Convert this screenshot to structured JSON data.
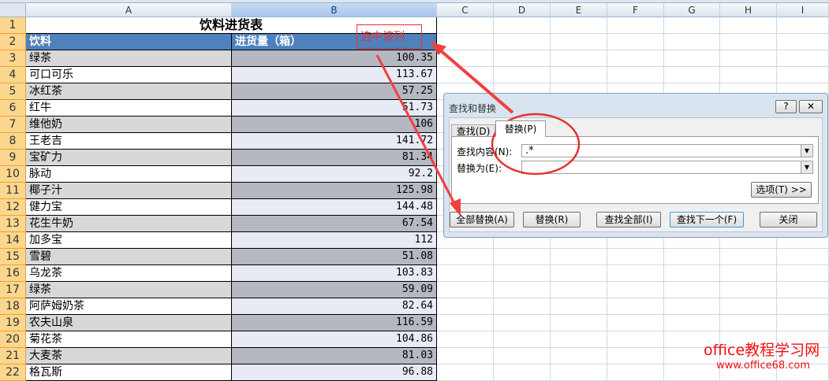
{
  "columns": [
    "A",
    "B",
    "C",
    "D",
    "E",
    "F",
    "G",
    "H",
    "I"
  ],
  "sheet": {
    "title": "饮料进货表",
    "headers": [
      "饮料",
      "进货量（箱）"
    ],
    "rows": [
      [
        "绿茶",
        "100.35"
      ],
      [
        "可口可乐",
        "113.67"
      ],
      [
        "冰红茶",
        "57.25"
      ],
      [
        "红牛",
        "51.73"
      ],
      [
        "维他奶",
        "106"
      ],
      [
        "王老吉",
        "141.72"
      ],
      [
        "宝矿力",
        "81.34"
      ],
      [
        "脉动",
        "92.2"
      ],
      [
        "椰子汁",
        "125.98"
      ],
      [
        "健力宝",
        "144.48"
      ],
      [
        "花生牛奶",
        "67.54"
      ],
      [
        "加多宝",
        "112"
      ],
      [
        "雪碧",
        "51.08"
      ],
      [
        "乌龙茶",
        "103.83"
      ],
      [
        "绿茶",
        "59.09"
      ],
      [
        "阿萨姆奶茶",
        "82.64"
      ],
      [
        "农夫山泉",
        "116.59"
      ],
      [
        "菊花茶",
        "104.86"
      ],
      [
        "大麦茶",
        "81.03"
      ],
      [
        "格瓦斯",
        "96.88"
      ]
    ]
  },
  "annotation": {
    "select_column": "选中该列"
  },
  "dialog": {
    "title": "查找和替换",
    "help": "?",
    "close_x": "✕",
    "tabs": [
      "查找(D)",
      "替换(P)"
    ],
    "find_label": "查找内容(N):",
    "find_value": ".*",
    "replace_label": "替换为(E):",
    "replace_value": "",
    "options": "选项(T) >>",
    "buttons": [
      "全部替换(A)",
      "替换(R)",
      "查找全部(I)",
      "查找下一个(F)",
      "关闭"
    ]
  },
  "watermark": {
    "line1": "office教程学习网",
    "line2": "www.office68.com"
  }
}
